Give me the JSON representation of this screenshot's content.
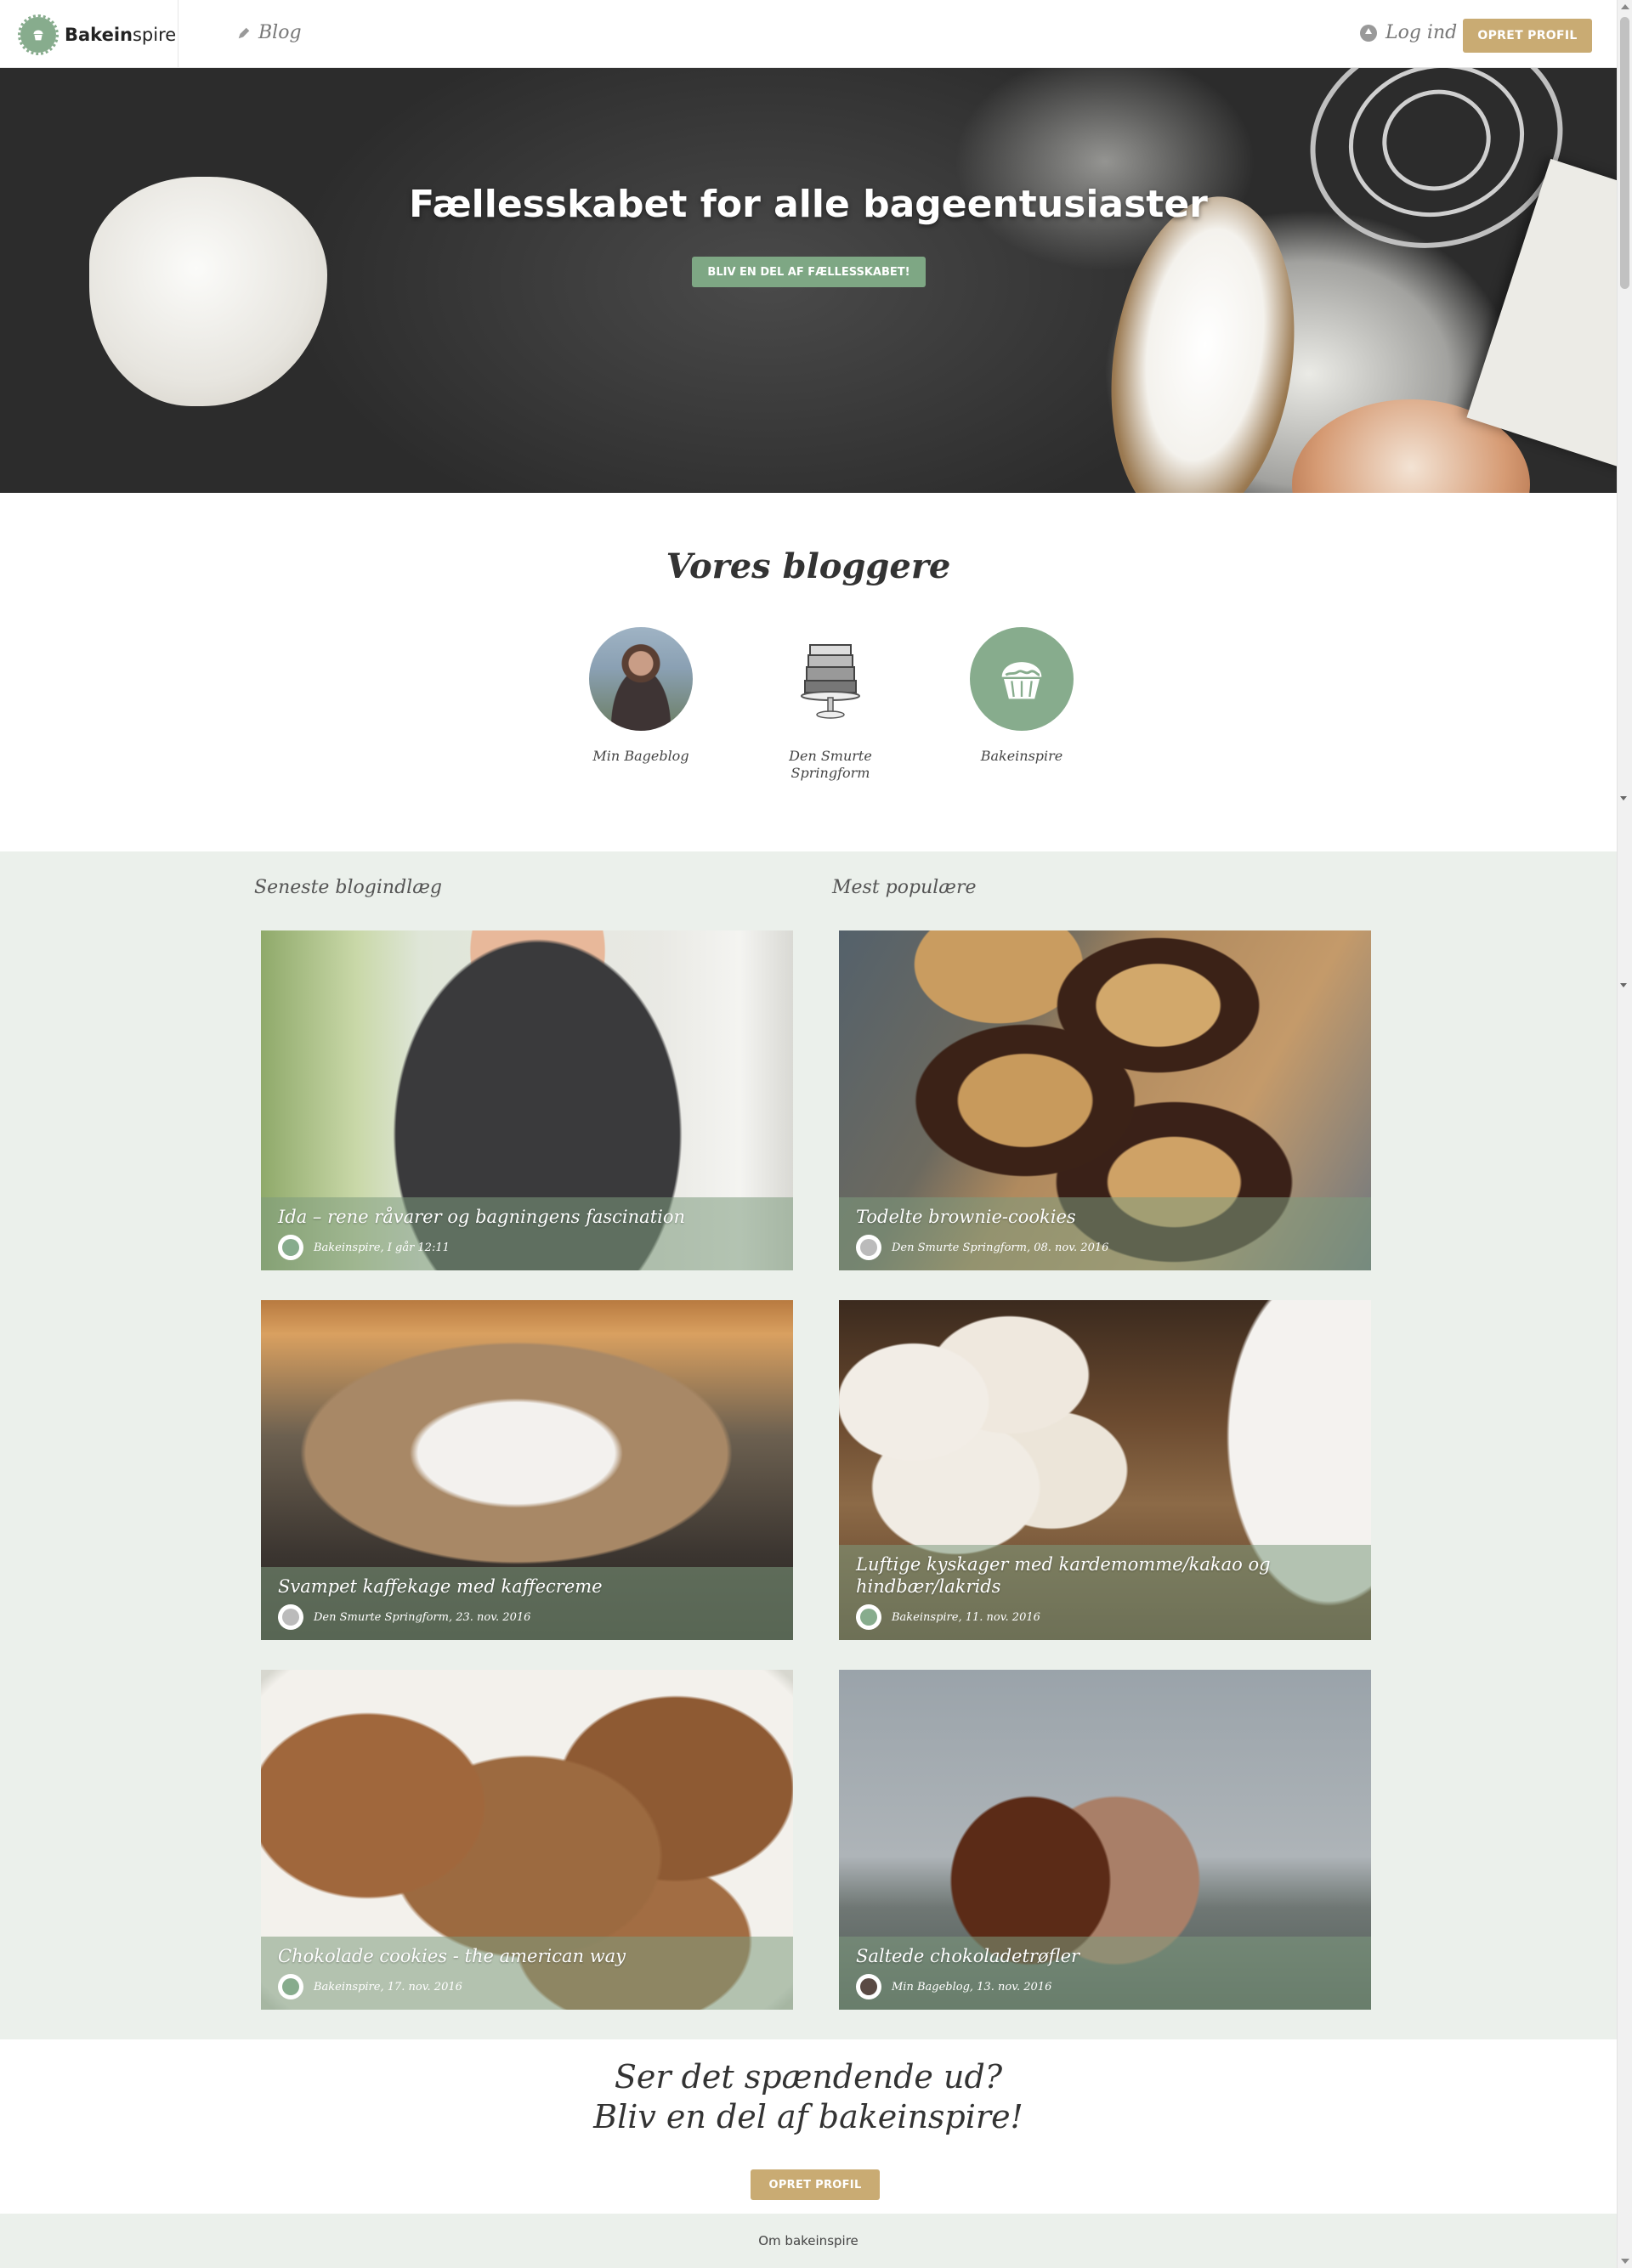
{
  "header": {
    "logo_bold": "Bake",
    "logo_mid": "in",
    "logo_rest": "spire",
    "nav_blog": "Blog",
    "login": "Log ind",
    "signup": "OPRET PROFIL"
  },
  "hero": {
    "title": "Fællesskabet for alle bageentusiaster",
    "cta": "BLIV EN DEL AF FÆLLESSKABET!"
  },
  "bloggers": {
    "title": "Vores bloggere",
    "items": [
      {
        "name": "Min Bageblog"
      },
      {
        "name": "Den Smurte Springform"
      },
      {
        "name": "Bakeinspire"
      }
    ]
  },
  "posts": {
    "latest_title": "Seneste blogindlæg",
    "popular_title": "Mest populære",
    "latest": [
      {
        "title": "Ida – rene råvarer og bagningens fascination",
        "meta": "Bakeinspire, I går 12:11"
      },
      {
        "title": "Svampet kaffekage med kaffecreme",
        "meta": "Den Smurte Springform, 23. nov. 2016"
      },
      {
        "title": "Chokolade cookies - the american way",
        "meta": "Bakeinspire, 17. nov. 2016"
      }
    ],
    "popular": [
      {
        "title": "Todelte brownie-cookies",
        "meta": "Den Smurte Springform, 08. nov. 2016"
      },
      {
        "title": "Luftige kyskager med kardemomme/kakao og hindbær/lakrids",
        "meta": "Bakeinspire, 11. nov. 2016"
      },
      {
        "title": "Saltede chokoladetrøfler",
        "meta": "Min Bageblog, 13. nov. 2016"
      }
    ]
  },
  "cta": {
    "line1": "Ser det spændende ud?",
    "line2": "Bliv en del af bakeinspire!",
    "button": "OPRET PROFIL"
  },
  "footer": {
    "link": "Om bakeinspire"
  },
  "colors": {
    "brand_green": "#87ac8d",
    "gold": "#c9ab73",
    "section_bg": "#ebf0eb"
  },
  "icons": [
    "cupcake-logo-icon",
    "pencil-icon",
    "login-arrow-icon"
  ]
}
